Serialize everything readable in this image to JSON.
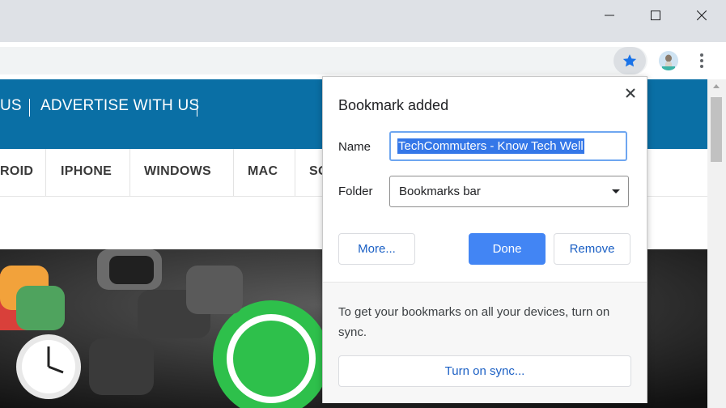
{
  "window": {
    "minimize_icon": "minimize-icon",
    "maximize_icon": "maximize-icon",
    "close_icon": "close-icon"
  },
  "toolbar": {
    "star_icon": "star-icon",
    "star_color": "#1a73e8",
    "profile_icon": "avatar",
    "menu_icon": "vertical-dots-icon"
  },
  "webpage": {
    "brand_color": "#0a6fa5",
    "top_nav": [
      {
        "label": "US"
      },
      {
        "label": "ADVERTISE WITH US"
      }
    ],
    "categories": [
      {
        "label": "ROID"
      },
      {
        "label": "IPHONE"
      },
      {
        "label": "WINDOWS"
      },
      {
        "label": "MAC"
      },
      {
        "label": "SO"
      }
    ]
  },
  "bookmark_bubble": {
    "title": "Bookmark added",
    "close_icon": "close-icon",
    "name_label": "Name",
    "name_value": "TechCommuters - Know Tech Well",
    "folder_label": "Folder",
    "folder_value": "Bookmarks bar",
    "more_button": "More...",
    "done_button": "Done",
    "remove_button": "Remove",
    "sync_text": "To get your bookmarks on all your devices, turn on sync.",
    "sync_button": "Turn on sync...",
    "accent_color": "#4285f4"
  }
}
